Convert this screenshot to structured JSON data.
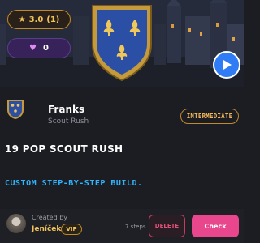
{
  "hero": {
    "rating": "3.0",
    "rating_count": "(1)",
    "likes": "0",
    "rating_icon": "star-icon",
    "likes_icon": "heart-icon",
    "play_icon": "play-icon"
  },
  "build": {
    "civilization": "Franks",
    "subtitle": "Scout Rush",
    "level": "INTERMEDIATE",
    "title": "19 POP SCOUT RUSH",
    "description": "CUSTOM STEP-BY-STEP BUILD."
  },
  "footer": {
    "created_by_label": "Created by",
    "author": "Jeníček",
    "vip_badge": "VIP",
    "steps": "7 steps",
    "delete_label": "DELETE",
    "check_label": "Check"
  },
  "colors": {
    "accent_gold": "#f3c35a",
    "accent_blue": "#2fb5ff",
    "play_blue": "#2f7cf4",
    "check_pink": "#e8478d",
    "delete_red": "#e3527a",
    "likes_purple": "#37225a"
  }
}
